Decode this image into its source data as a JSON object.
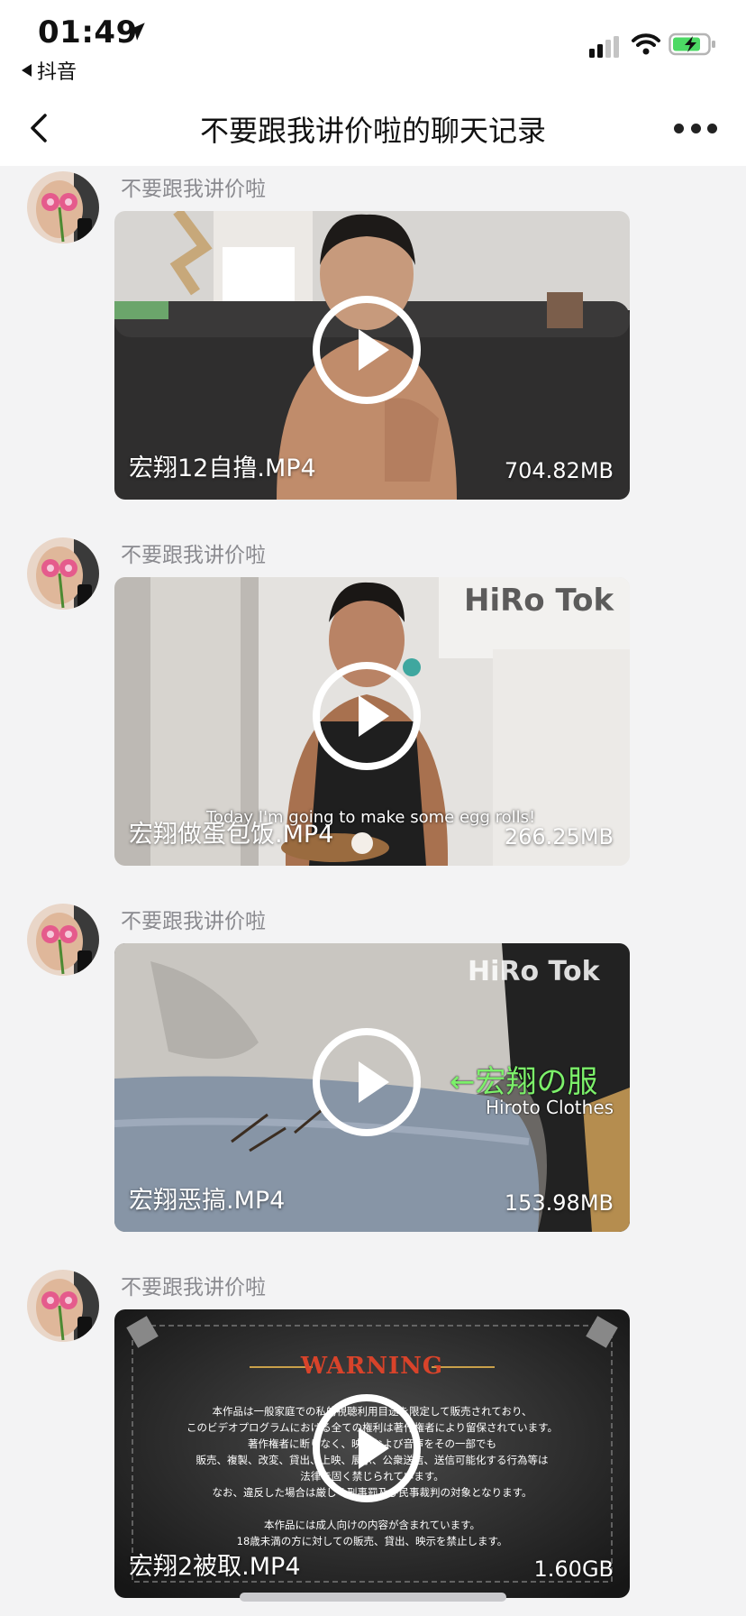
{
  "status_bar": {
    "time": "01:49",
    "back_app": "抖音",
    "icons": [
      "location-arrow-icon",
      "cellular-signal-icon",
      "wifi-icon",
      "battery-charging-icon"
    ]
  },
  "nav": {
    "title": "不要跟我讲价啦的聊天记录",
    "icons": [
      "back-chevron-icon",
      "more-dots-icon"
    ]
  },
  "messages": [
    {
      "sender": "不要跟我讲价啦",
      "file_name": "宏翔12自撸.MP4",
      "file_size": "704.82MB",
      "overlay": ""
    },
    {
      "sender": "不要跟我讲价啦",
      "file_name": "宏翔做蛋包饭.MP4",
      "file_size": "266.25MB",
      "overlay": "HiRo Tok",
      "subtitle": "Today I'm going to make some egg rolls!"
    },
    {
      "sender": "不要跟我讲价啦",
      "file_name": "宏翔恶搞.MP4",
      "file_size": "153.98MB",
      "overlay": "HiRo Tok",
      "caption_main": "←宏翔の服",
      "caption_sub": "Hiroto Clothes"
    },
    {
      "sender": "不要跟我讲价啦",
      "file_name": "宏翔2被取.MP4",
      "file_size": "1.60GB",
      "overlay": "WARNING",
      "warning_lines": [
        "本作品は一般家庭での私的視聴利用目途を限定して販売されており、",
        "このビデオプログラムにおける全ての権利は著作権者により留保されています。",
        "著作権者に断りなく、映像および音声をその一部でも",
        "販売、複製、改変、貸出、上映、展示、公衆送信、送信可能化する行為等は",
        "法律で固く禁じられています。",
        "なお、違反した場合は厳しく刑事罰及び民事裁判の対象となります。",
        "",
        "本作品には成人向けの内容が含まれています。",
        "18歳未満の方に対しての販売、貸出、映示を禁止します。"
      ]
    }
  ],
  "colors": {
    "background": "#f3f3f4",
    "header": "#ffffff",
    "sender_text": "#8a8a8f",
    "battery_green": "#4cd964",
    "caption_green": "#7cf06a",
    "warning_red": "#d8432a"
  }
}
